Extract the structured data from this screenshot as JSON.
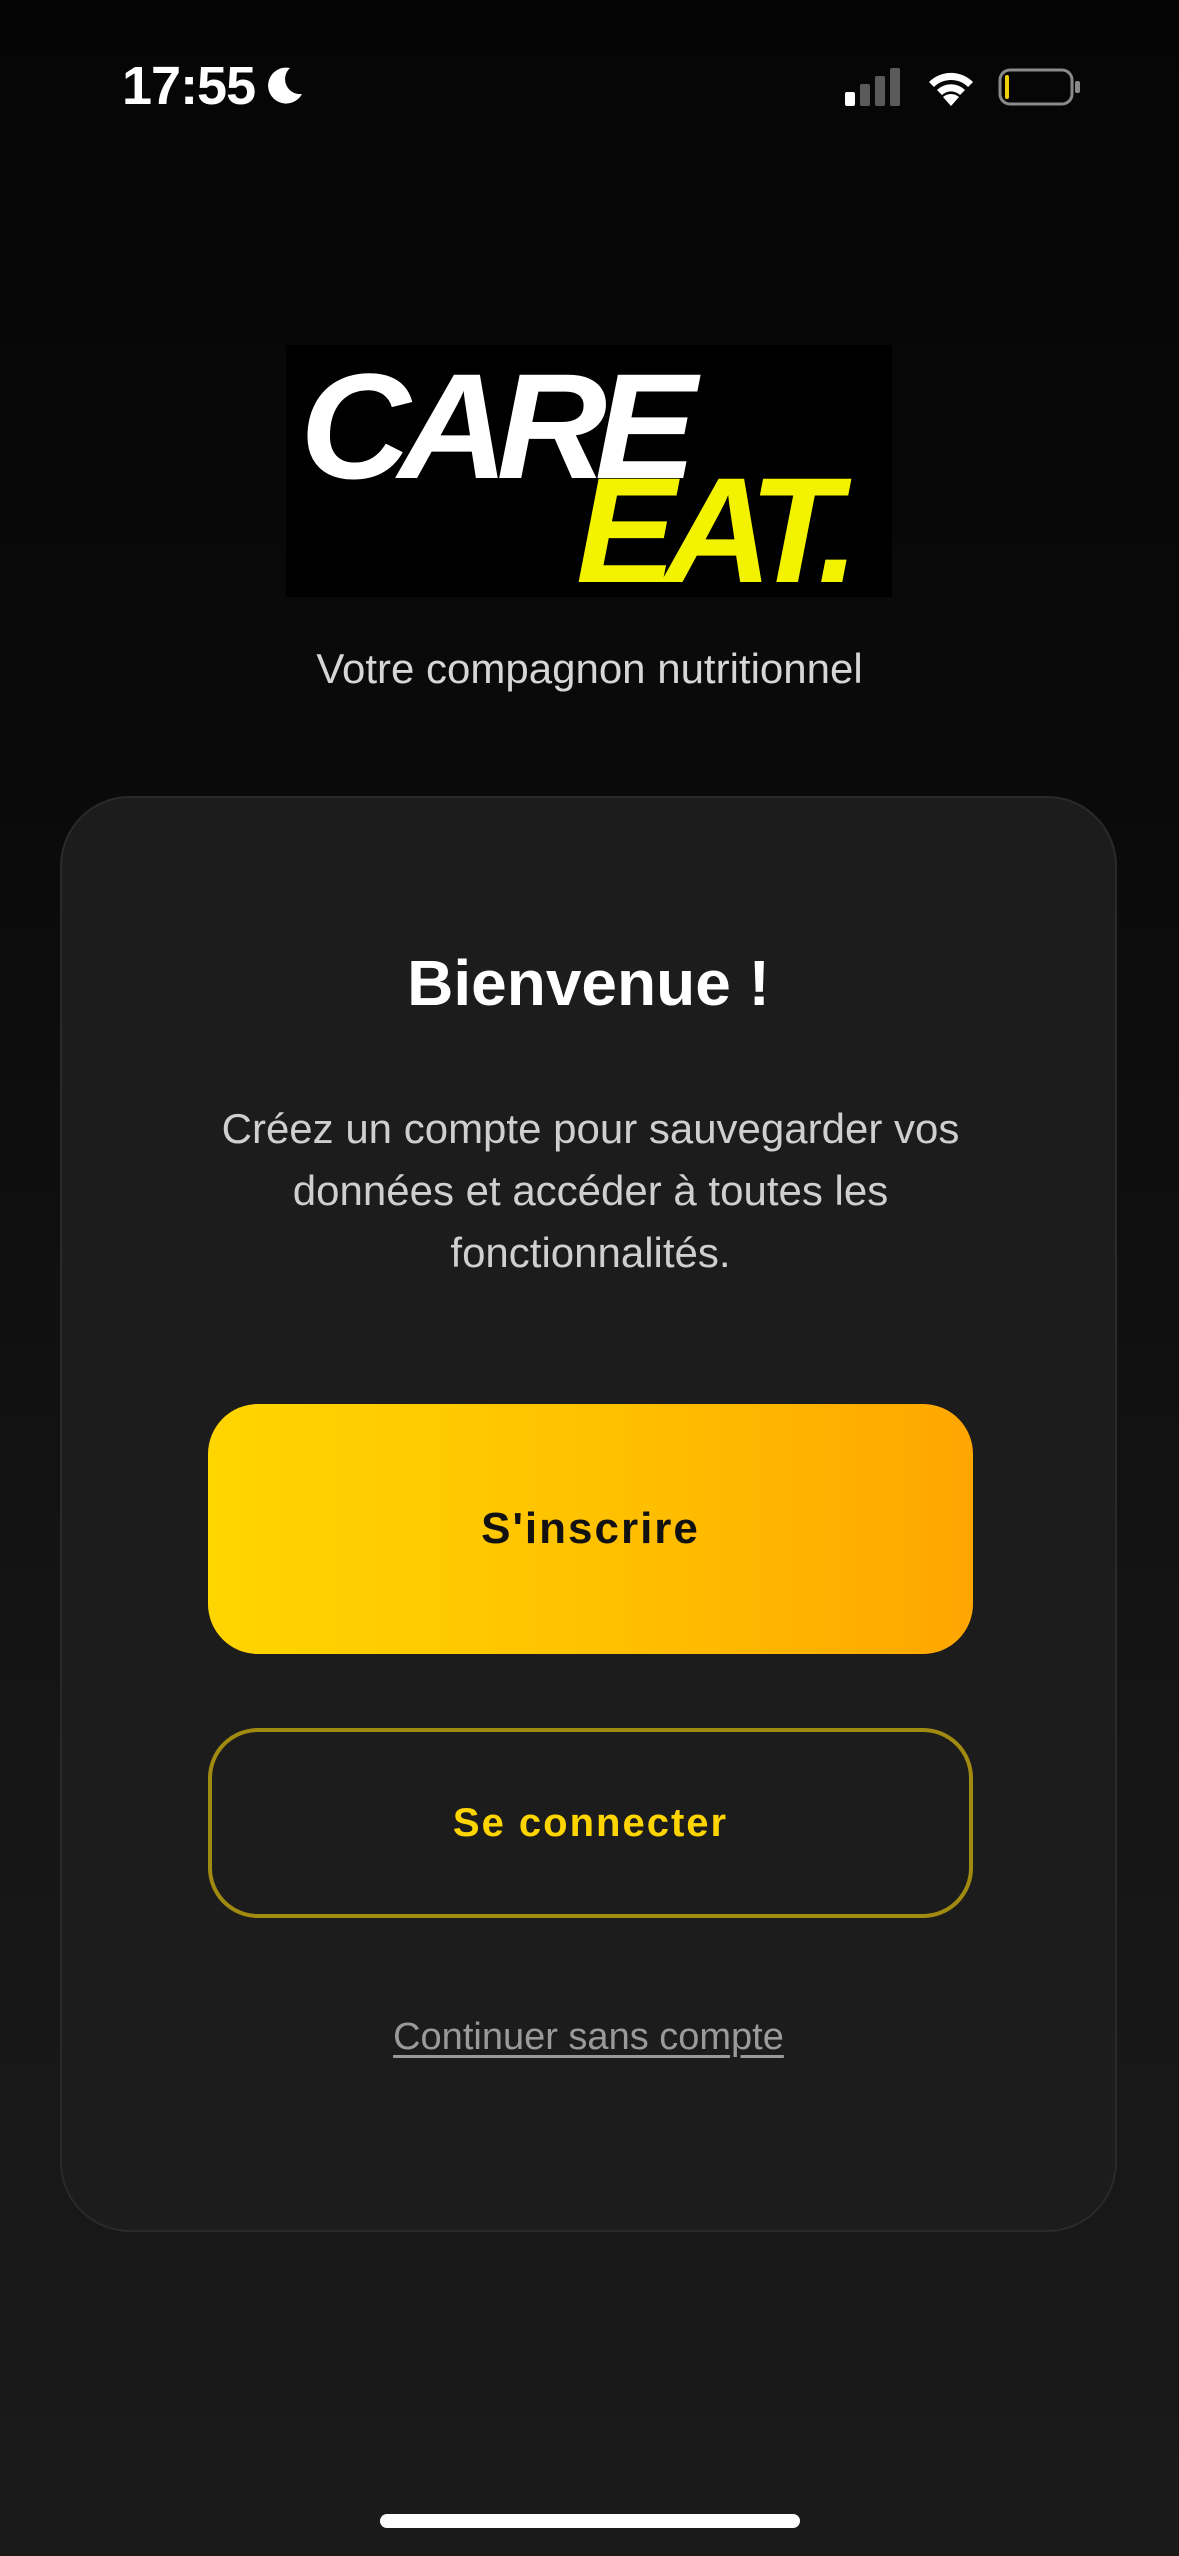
{
  "status_bar": {
    "time": "17:55",
    "icons": [
      "moon-icon",
      "signal-icon",
      "wifi-icon",
      "battery-icon"
    ],
    "battery_level": 0.05,
    "battery_color": "#f0d000"
  },
  "logo": {
    "line1": "CARE",
    "line2": "EAT.",
    "colors": {
      "line1": "#ffffff",
      "line2": "#f3f300",
      "background": "#000000"
    }
  },
  "tagline": "Votre compagnon nutritionnel",
  "card": {
    "title": "Bienvenue !",
    "description": "Créez un compte pour sauvegarder vos données et accéder à toutes les fonctionnalités.",
    "signup_label": "S'inscrire",
    "login_label": "Se connecter",
    "guest_label": "Continuer sans compte"
  },
  "colors": {
    "accent_gradient_start": "#ffd500",
    "accent_gradient_end": "#ffa600",
    "accent_text": "#ffd500",
    "card_background": "#1c1c1c"
  }
}
